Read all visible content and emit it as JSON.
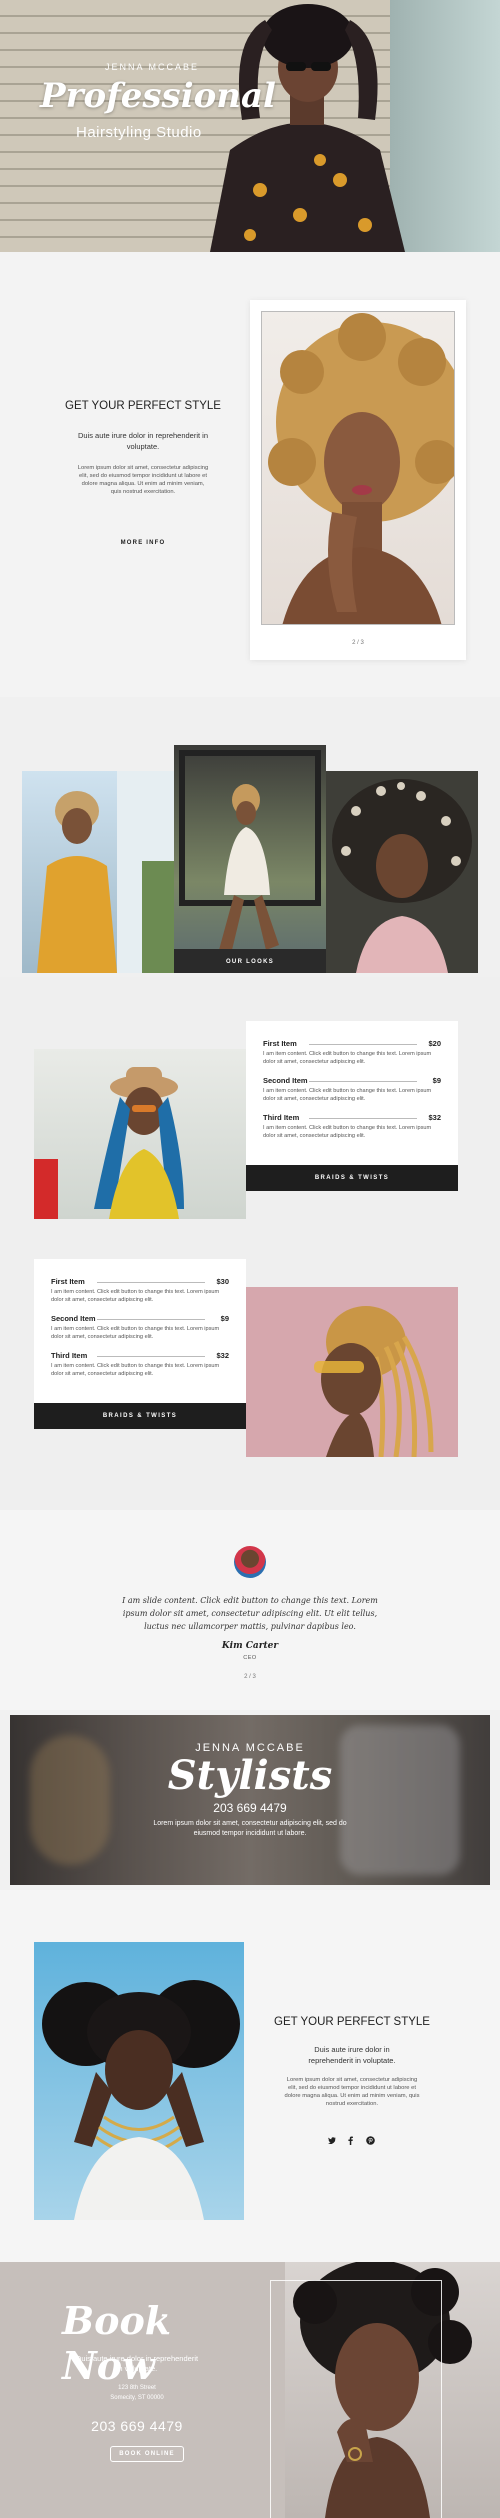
{
  "hero": {
    "kicker": "JENNA MCCABE",
    "title": "Professional",
    "subtitle": "Hairstyling Studio"
  },
  "intro": {
    "heading": "GET YOUR PERFECT STYLE",
    "lead": "Duis aute irure dolor in reprehenderit in voluptate.",
    "body": "Lorem ipsum dolor sit amet, consectetur adipiscing elit, sed do eiusmod tempor incididunt ut labore et dolore magna aliqua. Ut enim ad minim veniam, quis nostrud exercitation.",
    "button": "MORE INFO",
    "slide_counter": "2 / 3"
  },
  "looks": {
    "caption": "OUR LOOKS"
  },
  "menu1": {
    "items": [
      {
        "name": "First Item",
        "price": "$20",
        "desc": "I am item content. Click edit button to change this text. Lorem ipsum dolor sit amet, consectetur adipiscing elit."
      },
      {
        "name": "Second Item",
        "price": "$9",
        "desc": "I am item content. Click edit button to change this text. Lorem ipsum dolor sit amet, consectetur adipiscing elit."
      },
      {
        "name": "Third Item",
        "price": "$32",
        "desc": "I am item content. Click edit button to change this text. Lorem ipsum dolor sit amet, consectetur adipiscing elit."
      }
    ],
    "bar": "BRAIDS & TWISTS"
  },
  "menu2": {
    "items": [
      {
        "name": "First Item",
        "price": "$30",
        "desc": "I am item content. Click edit button to change this text. Lorem ipsum dolor sit amet, consectetur adipiscing elit."
      },
      {
        "name": "Second Item",
        "price": "$9",
        "desc": "I am item content. Click edit button to change this text. Lorem ipsum dolor sit amet, consectetur adipiscing elit."
      },
      {
        "name": "Third Item",
        "price": "$32",
        "desc": "I am item content. Click edit button to change this text. Lorem ipsum dolor sit amet, consectetur adipiscing elit."
      }
    ],
    "bar": "BRAIDS & TWISTS"
  },
  "testimonial": {
    "quote": "I am slide content. Click edit button to change this text. Lorem ipsum dolor sit amet, consectetur adipiscing elit. Ut elit tellus, luctus nec ullamcorper mattis, pulvinar dapibus leo.",
    "signature": "Kim Carter",
    "role": "CEO",
    "counter": "2 / 3"
  },
  "stylists": {
    "kicker": "JENNA MCCABE",
    "title": "Stylists",
    "phone": "203 669 4479",
    "text": "Lorem ipsum dolor sit amet, consectetur adipiscing elit, sed do eiusmod tempor incididunt ut labore."
  },
  "about": {
    "heading": "GET YOUR PERFECT STYLE",
    "lead": "Duis aute irure dolor in reprehenderit in voluptate.",
    "body": "Lorem ipsum dolor sit amet, consectetur adipiscing elit, sed do eiusmod tempor incididunt ut labore et dolore magna aliqua. Ut enim ad minim veniam, quis nostrud exercitation.",
    "social_icons": [
      "twitter-icon",
      "facebook-icon",
      "pinterest-icon"
    ]
  },
  "booking": {
    "title": "Book Now",
    "lead": "Duis aute irure dolor in reprehenderit in voluptate.",
    "address_line1": "123 8th Street",
    "address_line2": "Somecity, ST 00000",
    "phone": "203 669 4479",
    "button": "BOOK ONLINE"
  },
  "colors": {
    "accent_dark": "#1e1e1e",
    "page_bg": "#f1f1f1",
    "booking_bg": "#c6bfbb"
  }
}
